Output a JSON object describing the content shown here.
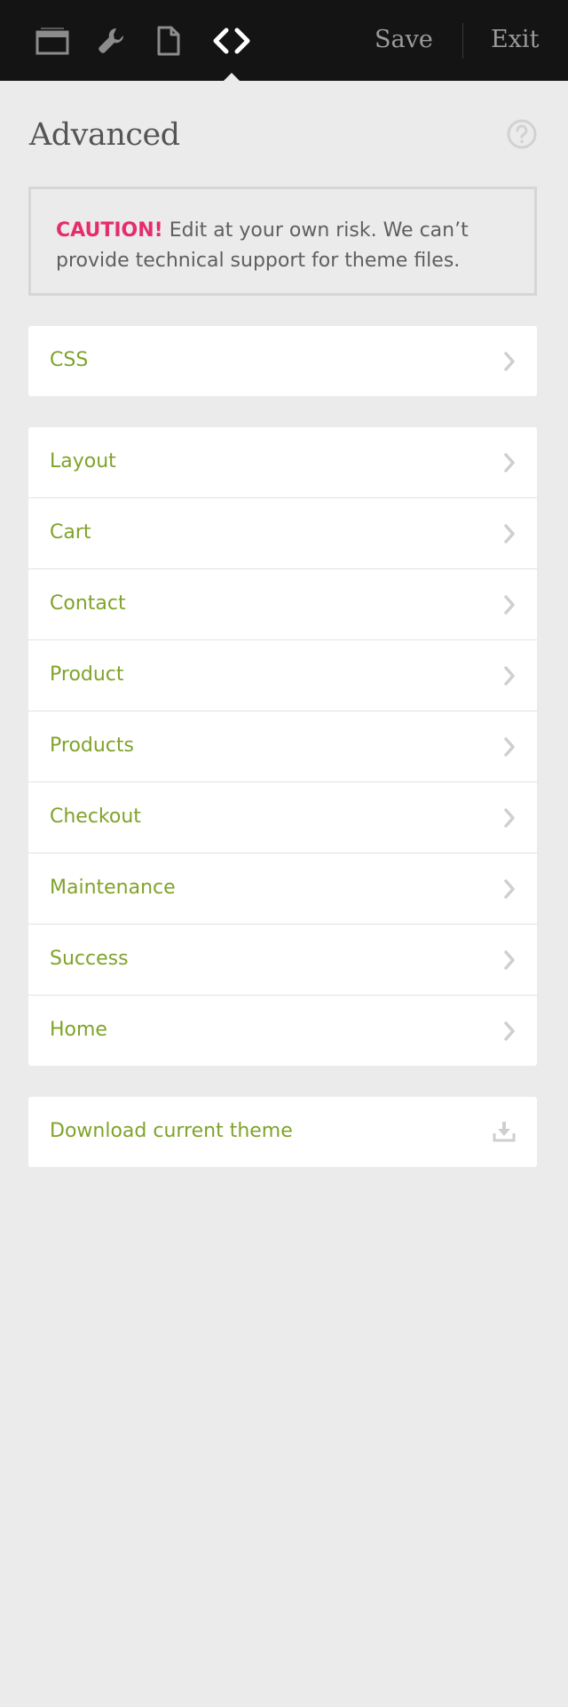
{
  "toolbar": {
    "icons": [
      {
        "name": "window-icon",
        "active": false
      },
      {
        "name": "wrench-icon",
        "active": false
      },
      {
        "name": "page-icon",
        "active": false
      },
      {
        "name": "code-icon",
        "active": true
      }
    ],
    "save_label": "Save",
    "exit_label": "Exit"
  },
  "header": {
    "title": "Advanced",
    "help_icon": "question-circle-icon"
  },
  "caution": {
    "label": "CAUTION!",
    "message": "Edit at your own risk. We can’t provide technical support for theme files."
  },
  "sections": {
    "css": [
      {
        "label": "CSS",
        "icon": "chevron-right-icon"
      }
    ],
    "pages": [
      {
        "label": "Layout",
        "icon": "chevron-right-icon"
      },
      {
        "label": "Cart",
        "icon": "chevron-right-icon"
      },
      {
        "label": "Contact",
        "icon": "chevron-right-icon"
      },
      {
        "label": "Product",
        "icon": "chevron-right-icon"
      },
      {
        "label": "Products",
        "icon": "chevron-right-icon"
      },
      {
        "label": "Checkout",
        "icon": "chevron-right-icon"
      },
      {
        "label": "Maintenance",
        "icon": "chevron-right-icon"
      },
      {
        "label": "Success",
        "icon": "chevron-right-icon"
      },
      {
        "label": "Home",
        "icon": "chevron-right-icon"
      }
    ],
    "download": {
      "label": "Download current theme",
      "icon": "download-icon"
    }
  },
  "colors": {
    "topbar": "#141414",
    "background": "#ebebeb",
    "link_green": "#7fa32a",
    "caution_pink": "#e52c6d",
    "muted_text": "#5f5f5f"
  }
}
